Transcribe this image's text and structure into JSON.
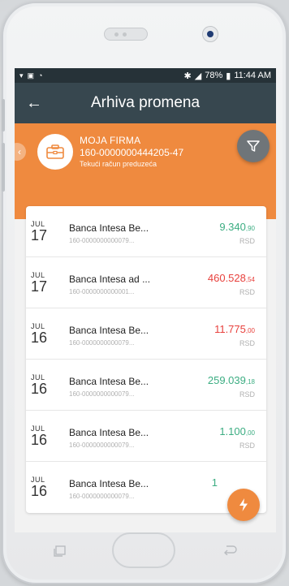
{
  "statusbar": {
    "left_icons": [
      "signal-icon",
      "image-icon",
      "notification-icon"
    ],
    "battery": "78%",
    "time": "11:44 AM"
  },
  "appbar": {
    "title": "Arhiva promena"
  },
  "account": {
    "name": "MOJA FIRMA",
    "number": "160-0000000444205-47",
    "type": "Tekući račun preduzeća"
  },
  "transactions": [
    {
      "month": "JUL",
      "day": "17",
      "payee": "Banca Intesa Be...",
      "account": "160-0000000000079...",
      "amount": "9.340",
      "decimals": ",90",
      "currency": "RSD",
      "color": "#3cad82"
    },
    {
      "month": "JUL",
      "day": "17",
      "payee": "Banca Intesa ad ...",
      "account": "160-0000000000001...",
      "amount": "460.528",
      "decimals": ",54",
      "currency": "RSD",
      "color": "#e8413d"
    },
    {
      "month": "JUL",
      "day": "16",
      "payee": "Banca Intesa Be...",
      "account": "160-0000000000079...",
      "amount": "11.775",
      "decimals": ",00",
      "currency": "RSD",
      "color": "#e8413d"
    },
    {
      "month": "JUL",
      "day": "16",
      "payee": "Banca Intesa Be...",
      "account": "160-0000000000079...",
      "amount": "259.039",
      "decimals": ",18",
      "currency": "RSD",
      "color": "#3cad82"
    },
    {
      "month": "JUL",
      "day": "16",
      "payee": "Banca Intesa Be...",
      "account": "160-0000000000079...",
      "amount": "1.100",
      "decimals": ",00",
      "currency": "RSD",
      "color": "#3cad82"
    },
    {
      "month": "JUL",
      "day": "16",
      "payee": "Banca Intesa Be...",
      "account": "160-0000000000079...",
      "amount": "1",
      "decimals": "",
      "currency": "",
      "color": "#3cad82"
    }
  ],
  "colors": {
    "accent": "#ef8a3f",
    "toolbar": "#37474f",
    "statusbar": "#263238"
  }
}
